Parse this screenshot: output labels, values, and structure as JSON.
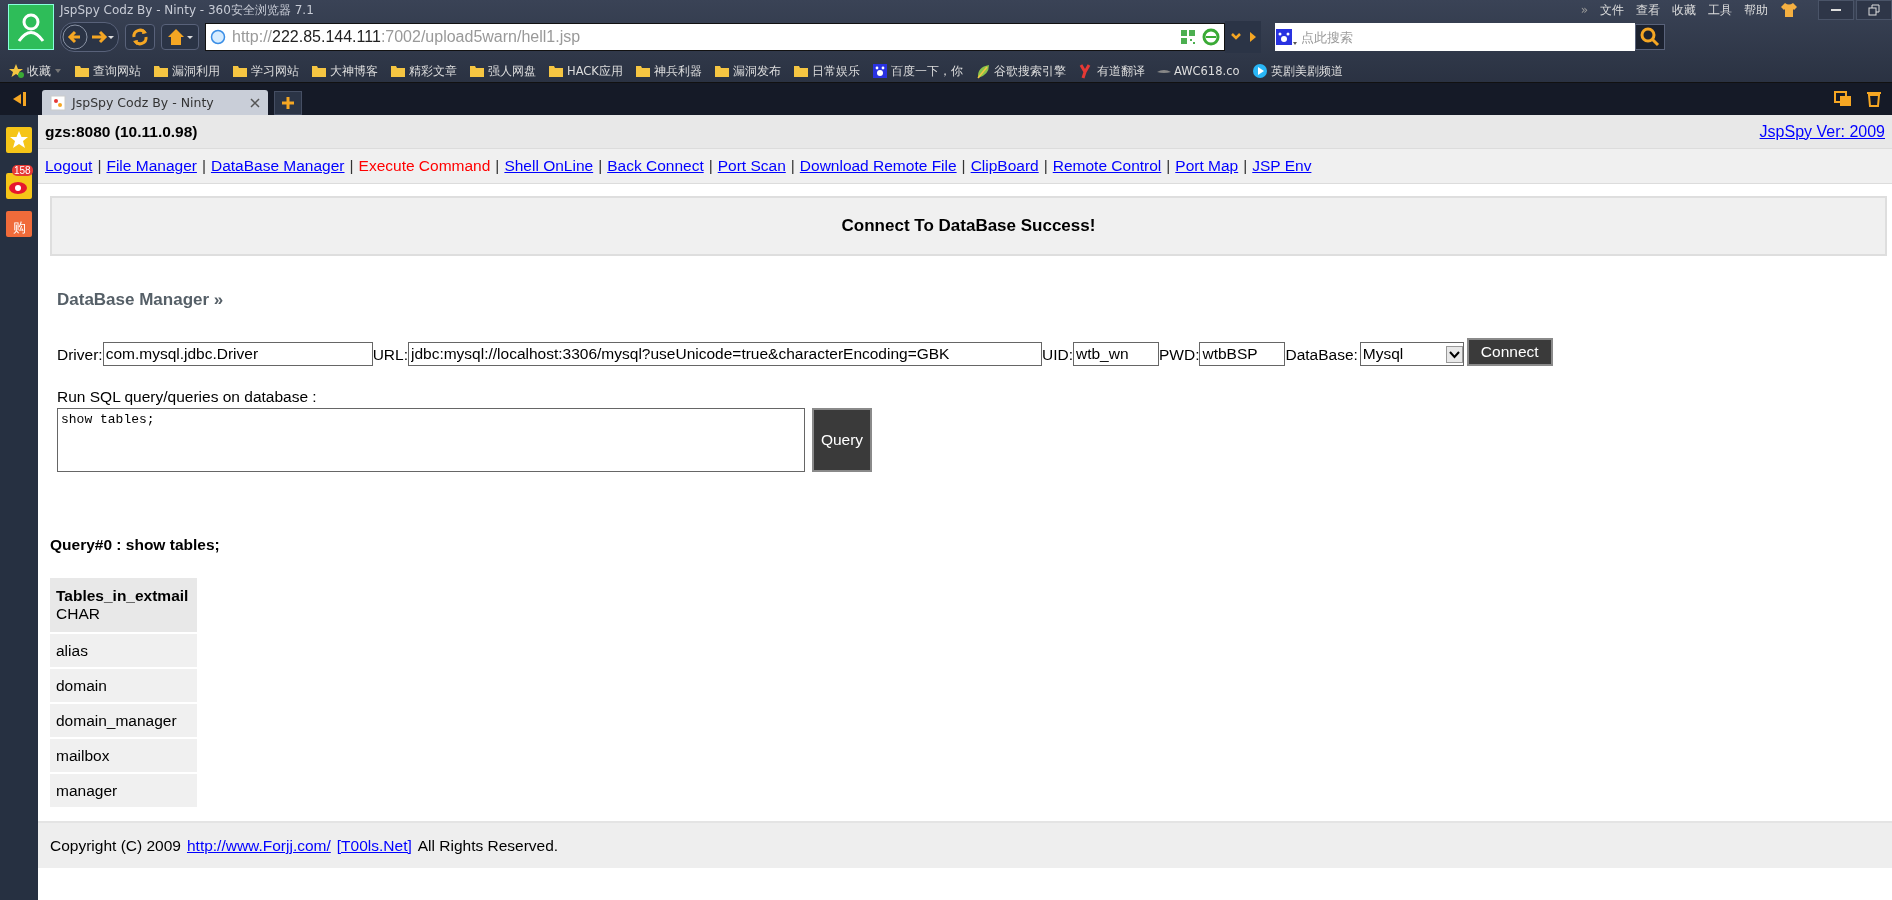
{
  "browser": {
    "title": "JspSpy Codz By - Ninty - 360安全浏览器 7.1",
    "menu": [
      "»",
      "文件",
      "查看",
      "收藏",
      "工具",
      "帮助"
    ],
    "address": {
      "scheme": "http://",
      "host": "222.85.144.111",
      "path": ":7002/upload5warn/hell1.jsp"
    },
    "search": {
      "placeholder": "点此搜索"
    },
    "bookmarks": [
      {
        "label": "收藏",
        "kind": "favorites"
      },
      {
        "label": "查询网站",
        "kind": "folder"
      },
      {
        "label": "漏洞利用",
        "kind": "folder"
      },
      {
        "label": "学习网站",
        "kind": "folder"
      },
      {
        "label": "大神博客",
        "kind": "folder"
      },
      {
        "label": "精彩文章",
        "kind": "folder"
      },
      {
        "label": "强人网盘",
        "kind": "folder"
      },
      {
        "label": "HACK应用",
        "kind": "folder"
      },
      {
        "label": "神兵利器",
        "kind": "folder"
      },
      {
        "label": "漏洞发布",
        "kind": "folder"
      },
      {
        "label": "日常娱乐",
        "kind": "folder"
      },
      {
        "label": "百度一下，你",
        "kind": "paw"
      },
      {
        "label": "谷歌搜索引擎",
        "kind": "leaf"
      },
      {
        "label": "有道翻译",
        "kind": "y"
      },
      {
        "label": "AWC618.co",
        "kind": "wing"
      },
      {
        "label": "英剧美剧频道",
        "kind": "play"
      }
    ],
    "tabs": [
      {
        "label": "JspSpy Codz By - Ninty",
        "selected": true
      }
    ],
    "sidebar": {
      "badge": "158",
      "shop_glyph": "购"
    }
  },
  "page": {
    "host": "gzs:8080 (10.11.0.98)",
    "version": "JspSpy Ver: 2009",
    "nav": [
      {
        "label": "Logout",
        "selected": false
      },
      {
        "label": "File Manager",
        "selected": false
      },
      {
        "label": "DataBase Manager",
        "selected": false
      },
      {
        "label": "Execute Command",
        "selected": true
      },
      {
        "label": "Shell OnLine",
        "selected": false
      },
      {
        "label": "Back Connect",
        "selected": false
      },
      {
        "label": "Port Scan",
        "selected": false
      },
      {
        "label": "Download Remote File",
        "selected": false
      },
      {
        "label": "ClipBoard",
        "selected": false
      },
      {
        "label": "Remote Control",
        "selected": false
      },
      {
        "label": "Port Map",
        "selected": false
      },
      {
        "label": "JSP Env",
        "selected": false
      }
    ],
    "nav_separator": "|",
    "message": "Connect To DataBase Success!",
    "section_title": "DataBase Manager »",
    "form": {
      "fields": [
        {
          "label": "Driver:",
          "value": "com.mysql.jdbc.Driver"
        },
        {
          "label": "URL:",
          "value": "jdbc:mysql://localhost:3306/mysql?useUnicode=true&characterEncoding=GBK"
        },
        {
          "label": "UID:",
          "value": "wtb_wn"
        },
        {
          "label": "PWD:",
          "value": "wtbBSP"
        }
      ],
      "database_label": "DataBase:",
      "database_value": "Mysql",
      "connect": "Connect"
    },
    "sql_label": "Run SQL query/queries on database :",
    "sql": "show tables;",
    "query_button": "Query",
    "result_title": "Query#0 : show tables;",
    "table": {
      "column": "Tables_in_extmail",
      "column_type": "CHAR",
      "rows": [
        "alias",
        "domain",
        "domain_manager",
        "mailbox",
        "manager"
      ]
    },
    "footer": {
      "text_before": "Copyright (C) 2009",
      "link1": "http://www.Forjj.com/",
      "link2": "[T00ls.Net]",
      "text_after": "All Rights Reserved."
    }
  }
}
